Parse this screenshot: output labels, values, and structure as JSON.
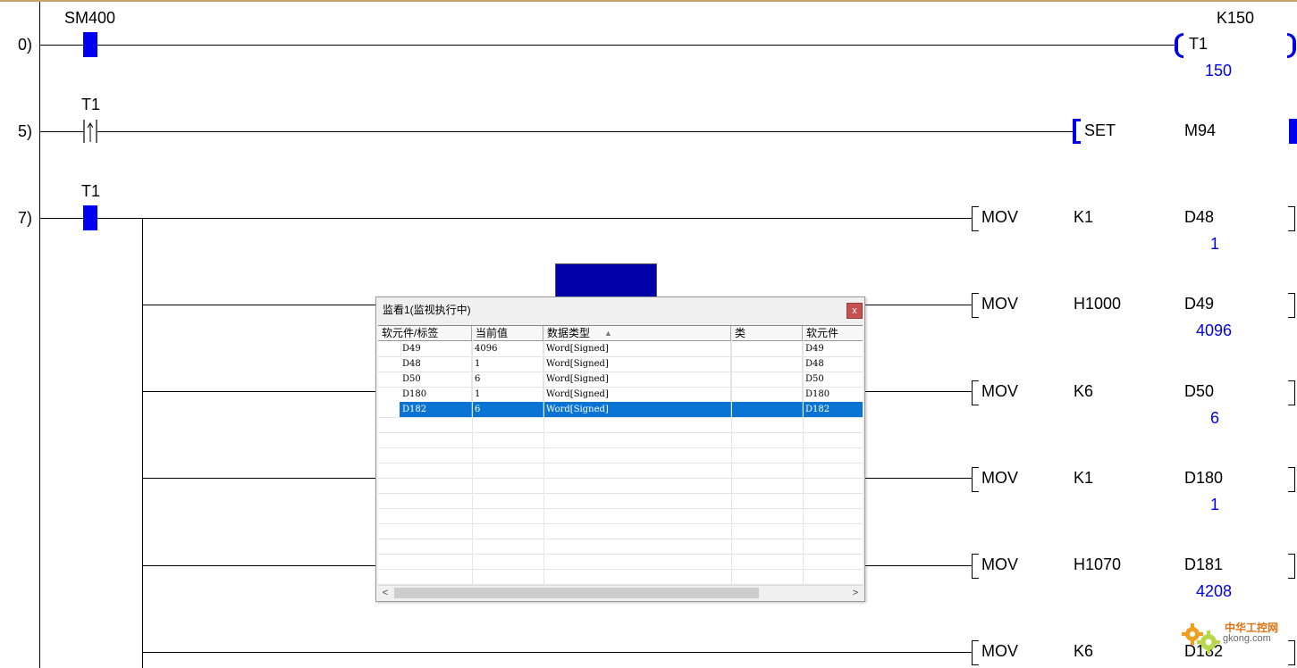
{
  "rungs": [
    {
      "step": "0)",
      "contact": "SM400",
      "coil": "T1",
      "coil_setting": "K150",
      "coil_value": "150"
    },
    {
      "step": "5)",
      "contact": "T1",
      "instruction": "SET",
      "operand": "M94"
    },
    {
      "step": "7)",
      "contact": "T1"
    }
  ],
  "movs": [
    {
      "op": "MOV",
      "src": "K1",
      "dst": "D48",
      "value": "1"
    },
    {
      "op": "MOV",
      "src": "H1000",
      "dst": "D49",
      "value": "4096"
    },
    {
      "op": "MOV",
      "src": "K6",
      "dst": "D50",
      "value": "6"
    },
    {
      "op": "MOV",
      "src": "K1",
      "dst": "D180",
      "value": "1"
    },
    {
      "op": "MOV",
      "src": "H1070",
      "dst": "D181",
      "value": "4208"
    },
    {
      "op": "MOV",
      "src": "K6",
      "dst": "D182"
    }
  ],
  "watch": {
    "title": "监看1(监视执行中)",
    "close": "x",
    "columns": [
      "软元件/标签",
      "当前值",
      "数据类型",
      "类",
      "软元件"
    ],
    "sort_indicator": "▲",
    "rows": [
      {
        "device": "D49",
        "value": "4096",
        "type": "Word[Signed]",
        "cls": "",
        "dev2": "D49"
      },
      {
        "device": "D48",
        "value": "1",
        "type": "Word[Signed]",
        "cls": "",
        "dev2": "D48"
      },
      {
        "device": "D50",
        "value": "6",
        "type": "Word[Signed]",
        "cls": "",
        "dev2": "D50"
      },
      {
        "device": "D180",
        "value": "1",
        "type": "Word[Signed]",
        "cls": "",
        "dev2": "D180"
      },
      {
        "device": "D182",
        "value": "6",
        "type": "Word[Signed]",
        "cls": "",
        "dev2": "D182"
      }
    ],
    "scroll_left": "<",
    "scroll_right": ">"
  },
  "watermark": {
    "text": "中华工控网",
    "url": "gkong.com"
  },
  "colors": {
    "contact": "#0000ee",
    "value": "#0000ee",
    "selection": "#0a74d4",
    "close": "#c75050"
  }
}
